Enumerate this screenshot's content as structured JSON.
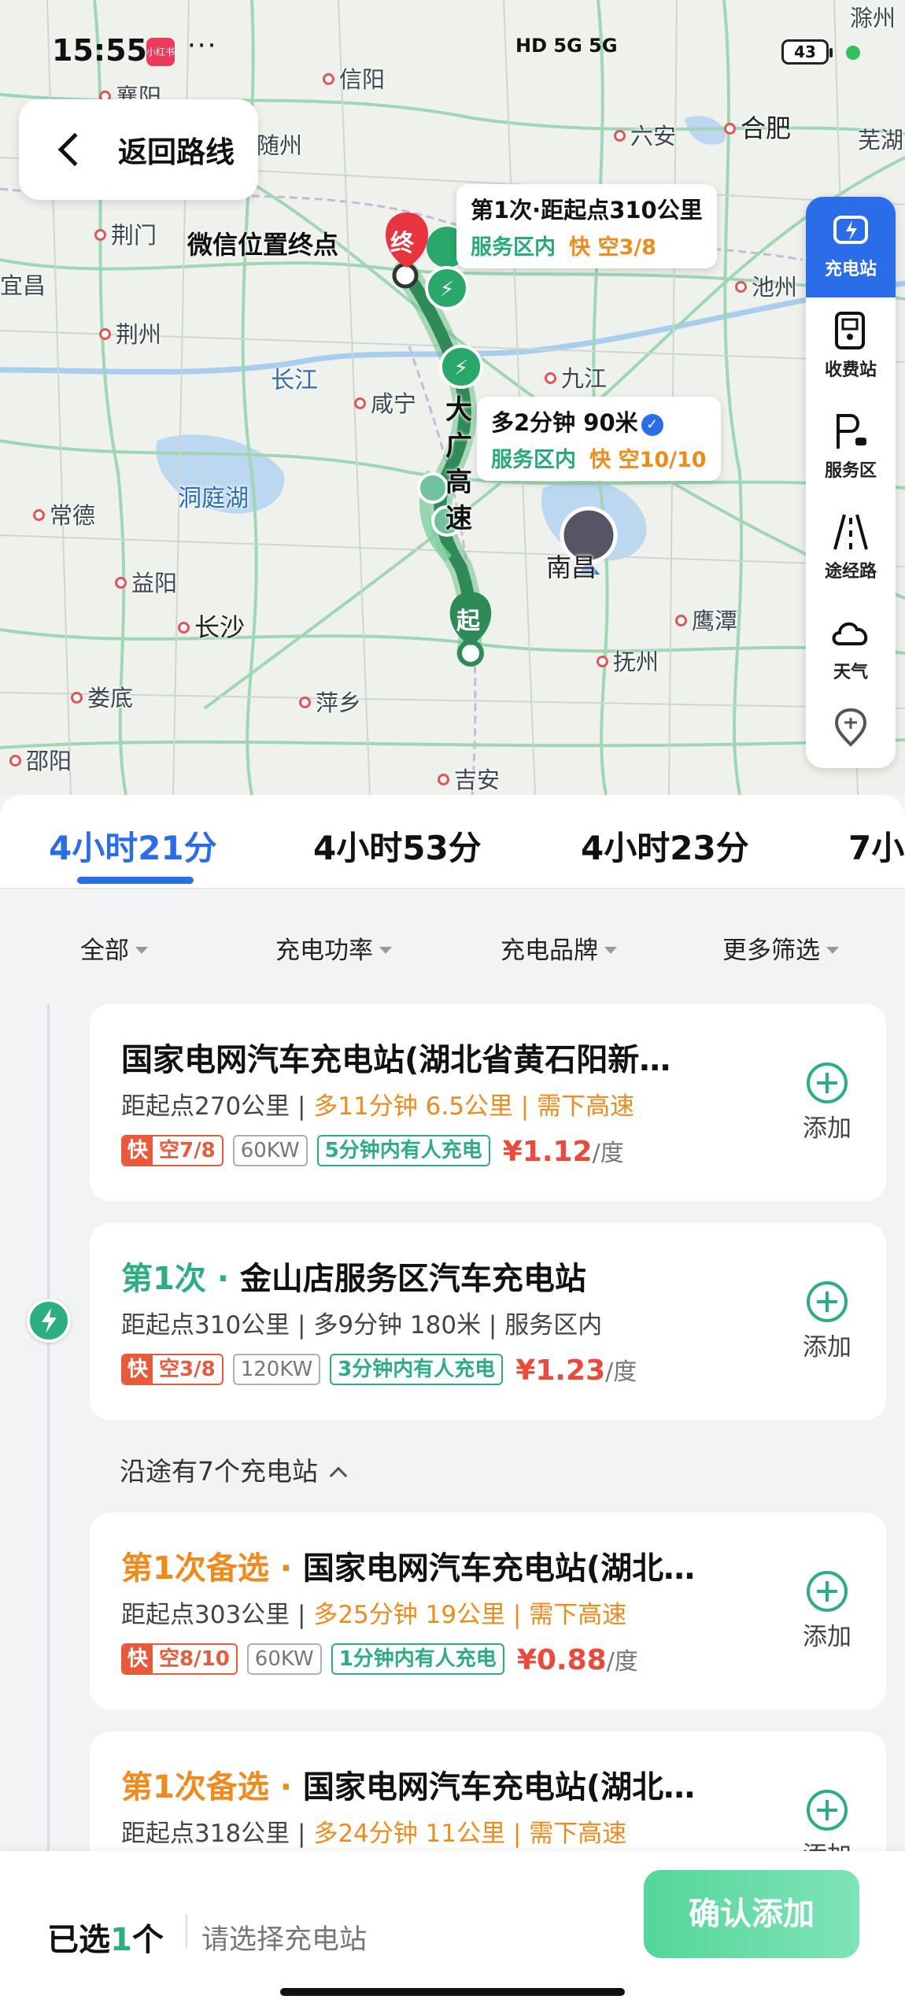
{
  "status_bar": {
    "time": "15:55",
    "app_tag": "小红书",
    "more": "···",
    "signals": "HD 5G 5G",
    "battery": "43"
  },
  "back": {
    "label": "返回路线"
  },
  "map": {
    "cities": [
      {
        "name": "襄阳",
        "class": "dot"
      },
      {
        "name": "信阳",
        "class": "dot"
      },
      {
        "name": "随州",
        "class": ""
      },
      {
        "name": "六安",
        "class": "dot"
      },
      {
        "name": "合肥",
        "class": "big dot"
      },
      {
        "name": "芜湖",
        "class": ""
      },
      {
        "name": "滁州",
        "class": ""
      },
      {
        "name": "荆门",
        "class": "dot"
      },
      {
        "name": "宜昌",
        "class": ""
      },
      {
        "name": "荆州",
        "class": "dot"
      },
      {
        "name": "长江",
        "class": "blue"
      },
      {
        "name": "咸宁",
        "class": "dot"
      },
      {
        "name": "九江",
        "class": "dot"
      },
      {
        "name": "池州",
        "class": "dot"
      },
      {
        "name": "常德",
        "class": "dot"
      },
      {
        "name": "洞庭湖",
        "class": "blue"
      },
      {
        "name": "益阳",
        "class": "dot"
      },
      {
        "name": "长沙",
        "class": "big dot"
      },
      {
        "name": "鹰潭",
        "class": "dot"
      },
      {
        "name": "抚州",
        "class": "dot"
      },
      {
        "name": "娄底",
        "class": "dot"
      },
      {
        "name": "萍乡",
        "class": "dot"
      },
      {
        "name": "邵阳",
        "class": "dot"
      },
      {
        "name": "吉安",
        "class": "dot"
      },
      {
        "name": "南昌",
        "class": "big"
      }
    ],
    "end_label": "微信位置终点",
    "end_marker": "终",
    "start_marker": "起",
    "road_label": "大广高速",
    "callout1": {
      "title": "第1次·距起点310公里",
      "area": "服务区内",
      "fast": "快 空3/8"
    },
    "callout2": {
      "title": "多2分钟 90米",
      "area": "服务区内",
      "fast": "快 空10/10"
    }
  },
  "tools": [
    {
      "label": "充电站",
      "icon": "charging-station-icon"
    },
    {
      "label": "收费站",
      "icon": "toll-station-icon"
    },
    {
      "label": "服务区",
      "icon": "service-area-icon"
    },
    {
      "label": "途经路",
      "icon": "via-road-icon"
    },
    {
      "label": "天气",
      "icon": "weather-icon"
    },
    {
      "label": "",
      "icon": "location-pin-icon"
    }
  ],
  "route_tabs": [
    "4小时21分",
    "4小时53分",
    "4小时23分",
    "7小"
  ],
  "filters": [
    "全部",
    "充电功率",
    "充电品牌",
    "更多筛选"
  ],
  "cards": [
    {
      "prefix": "",
      "name": "国家电网汽车充电站(湖北省黄石阳新…",
      "meta_a": "距起点270公里 | ",
      "meta_b": "多11分钟 6.5公里 | 需下高速",
      "fast_k": "快",
      "fast_v": "空7/8",
      "kw": "60KW",
      "busy": "5分钟内有人充电",
      "price": "¥1.12",
      "unit": "/度",
      "add": "添加"
    },
    {
      "prefix": "第1次 · ",
      "name": "金山店服务区汽车充电站",
      "meta_a": "距起点310公里 | 多9分钟 180米 | 服务区内",
      "meta_b": "",
      "fast_k": "快",
      "fast_v": "空3/8",
      "kw": "120KW",
      "busy": "3分钟内有人充电",
      "price": "¥1.23",
      "unit": "/度",
      "add": "添加"
    },
    {
      "prefix": "第1次备选 · ",
      "name": "国家电网汽车充电站(湖北…",
      "meta_a": "距起点303公里 | ",
      "meta_b": "多25分钟 19公里 | 需下高速",
      "fast_k": "快",
      "fast_v": "空8/10",
      "kw": "60KW",
      "busy": "1分钟内有人充电",
      "price": "¥0.88",
      "unit": "/度",
      "add": "添加"
    },
    {
      "prefix": "第1次备选 · ",
      "name": "国家电网汽车充电站(湖北…",
      "meta_a": "距起点318公里 | ",
      "meta_b": "多24分钟 11公里 | 需下高速",
      "add": "添加"
    }
  ],
  "along": "沿途有7个充电站",
  "bottom": {
    "selected_a": "已选",
    "selected_n": "1",
    "selected_b": "个",
    "hint": "请选择充电站",
    "confirm": "确认添加"
  }
}
